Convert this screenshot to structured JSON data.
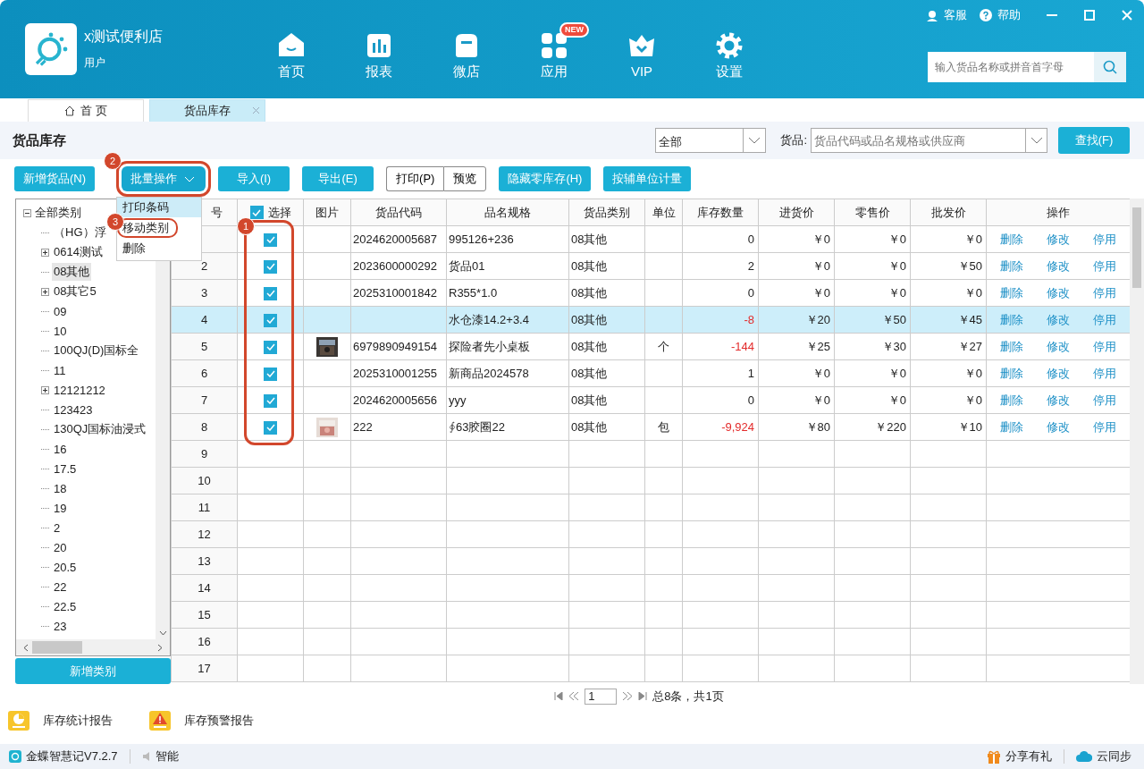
{
  "app": {
    "store_name": "x测试便利店",
    "user_role": "用户"
  },
  "top_links": [
    {
      "kind": "service",
      "label": "客服"
    },
    {
      "kind": "help",
      "label": "帮助"
    }
  ],
  "nav": [
    {
      "kind": "home",
      "label": "首页"
    },
    {
      "kind": "report",
      "label": "报表"
    },
    {
      "kind": "shop",
      "label": "微店"
    },
    {
      "kind": "apps",
      "label": "应用",
      "badge": "NEW"
    },
    {
      "kind": "vip",
      "label": "VIP"
    },
    {
      "kind": "settings",
      "label": "设置"
    }
  ],
  "search": {
    "placeholder": "输入货品名称或拼音首字母"
  },
  "tabs": [
    {
      "label": "首 页",
      "selected": false,
      "closable": false
    },
    {
      "label": "货品库存",
      "selected": true,
      "closable": true
    }
  ],
  "page_title": "货品库存",
  "filter": {
    "scope": "全部",
    "goods_label": "货品:",
    "goods_placeholder": "货品代码或品名规格或供应商",
    "find_button": "查找(F)"
  },
  "toolbar": [
    {
      "kind": "button",
      "label": "新增货品(N)"
    },
    {
      "kind": "dropdown",
      "label": "批量操作",
      "open": true,
      "callout": "2"
    },
    {
      "kind": "button",
      "label": "导入(I)"
    },
    {
      "kind": "button",
      "label": "导出(E)"
    },
    {
      "kind": "outline",
      "label": "打印(P)"
    },
    {
      "kind": "outline",
      "label": "预览"
    },
    {
      "kind": "button",
      "label": "隐藏零库存(H)"
    },
    {
      "kind": "button",
      "label": "按辅单位计量"
    }
  ],
  "batch_menu": [
    {
      "label": "打印条码",
      "selected": true
    },
    {
      "label": "移动类别",
      "selected": false,
      "callout": "3"
    },
    {
      "label": "删除",
      "selected": false
    }
  ],
  "tree": {
    "label": "全部类别",
    "expanded": true,
    "children": [
      {
        "label": "（HG）浮",
        "collapsed": false,
        "selected": false
      },
      {
        "label": "0614测试",
        "collapsed": true,
        "selected": false
      },
      {
        "label": "08其他",
        "collapsed": false,
        "selected": true
      },
      {
        "label": "08其它5",
        "collapsed": true,
        "selected": false
      },
      {
        "label": "09",
        "collapsed": false,
        "selected": false
      },
      {
        "label": "10",
        "collapsed": false,
        "selected": false
      },
      {
        "label": "100QJ(D)国标全",
        "collapsed": false,
        "selected": false
      },
      {
        "label": "11",
        "collapsed": false,
        "selected": false
      },
      {
        "label": "12121212",
        "collapsed": true,
        "selected": false
      },
      {
        "label": "123423",
        "collapsed": false,
        "selected": false
      },
      {
        "label": "130QJ国标油浸式",
        "collapsed": false,
        "selected": false
      },
      {
        "label": "16",
        "collapsed": false,
        "selected": false
      },
      {
        "label": "17.5",
        "collapsed": false,
        "selected": false
      },
      {
        "label": "18",
        "collapsed": false,
        "selected": false
      },
      {
        "label": "19",
        "collapsed": false,
        "selected": false
      },
      {
        "label": "2",
        "collapsed": false,
        "selected": false
      },
      {
        "label": "20",
        "collapsed": false,
        "selected": false
      },
      {
        "label": "20.5",
        "collapsed": false,
        "selected": false
      },
      {
        "label": "22",
        "collapsed": false,
        "selected": false
      },
      {
        "label": "22.5",
        "collapsed": false,
        "selected": false
      },
      {
        "label": "23",
        "collapsed": false,
        "selected": false
      }
    ]
  },
  "add_category_button": "新增类别",
  "table": {
    "columns": [
      "号",
      "选择",
      "图片",
      "货品代码",
      "品名规格",
      "货品类别",
      "单位",
      "库存数量",
      "进货价",
      "零售价",
      "批发价",
      "操作"
    ],
    "select_all": true,
    "checkbox_callout": "1",
    "rows": [
      {
        "checked": true,
        "selected": false,
        "picture": false,
        "code": "2024620005687",
        "name": "995126+236",
        "category": "08其他",
        "unit": "",
        "qty": "0",
        "negative": false,
        "buy": "￥0",
        "retail": "￥0",
        "wholesale": "￥0",
        "actions": [
          "删除",
          "修改",
          "停用"
        ]
      },
      {
        "no": "2",
        "checked": true,
        "selected": false,
        "picture": false,
        "code": "2023600000292",
        "name": "货品01",
        "category": "08其他",
        "unit": "",
        "qty": "2",
        "negative": false,
        "buy": "￥0",
        "retail": "￥0",
        "wholesale": "￥50",
        "actions": [
          "删除",
          "修改",
          "停用"
        ]
      },
      {
        "no": "3",
        "checked": true,
        "selected": false,
        "picture": false,
        "code": "2025310001842",
        "name": "R355*1.0",
        "category": "08其他",
        "unit": "",
        "qty": "0",
        "negative": false,
        "buy": "￥0",
        "retail": "￥0",
        "wholesale": "￥0",
        "actions": [
          "删除",
          "修改",
          "停用"
        ]
      },
      {
        "no": "4",
        "checked": true,
        "selected": true,
        "picture": false,
        "code": "",
        "name": "水仓漆14.2+3.4",
        "category": "08其他",
        "unit": "",
        "qty": "-8",
        "negative": true,
        "buy": "￥20",
        "retail": "￥50",
        "wholesale": "￥45",
        "actions": [
          "删除",
          "修改",
          "停用"
        ]
      },
      {
        "no": "5",
        "checked": true,
        "selected": false,
        "picture": true,
        "code": "6979890949154",
        "name": "探险者先小桌板",
        "category": "08其他",
        "unit": "个",
        "qty": "-144",
        "negative": true,
        "buy": "￥25",
        "retail": "￥30",
        "wholesale": "￥27",
        "actions": [
          "删除",
          "修改",
          "停用"
        ]
      },
      {
        "no": "6",
        "checked": true,
        "selected": false,
        "picture": false,
        "code": "2025310001255",
        "name": "新商品2024578",
        "category": "08其他",
        "unit": "",
        "qty": "1",
        "negative": false,
        "buy": "￥0",
        "retail": "￥0",
        "wholesale": "￥0",
        "actions": [
          "删除",
          "修改",
          "停用"
        ]
      },
      {
        "no": "7",
        "checked": true,
        "selected": false,
        "picture": false,
        "code": "2024620005656",
        "name": "yyy",
        "category": "08其他",
        "unit": "",
        "qty": "0",
        "negative": false,
        "buy": "￥0",
        "retail": "￥0",
        "wholesale": "￥0",
        "actions": [
          "删除",
          "修改",
          "停用"
        ]
      },
      {
        "no": "8",
        "checked": true,
        "selected": false,
        "picture": true,
        "code": "222",
        "name": "∮63胶圈22",
        "category": "08其他",
        "unit": "包",
        "qty": "-9,924",
        "negative": true,
        "buy": "￥80",
        "retail": "￥220",
        "wholesale": "￥10",
        "actions": [
          "删除",
          "修改",
          "停用"
        ]
      }
    ],
    "empty_rows": [
      "9",
      "10",
      "11",
      "12",
      "13",
      "14",
      "15",
      "16",
      "17"
    ]
  },
  "pager": {
    "page": "1",
    "summary": "总8条，共1页"
  },
  "reports": [
    {
      "kind": "stats",
      "label": "库存统计报告"
    },
    {
      "kind": "warning",
      "label": "库存预警报告"
    }
  ],
  "status_bar": {
    "version": "金蝶智慧记V7.2.7",
    "mode": "智能",
    "share": "分享有礼",
    "sync": "云同步"
  }
}
